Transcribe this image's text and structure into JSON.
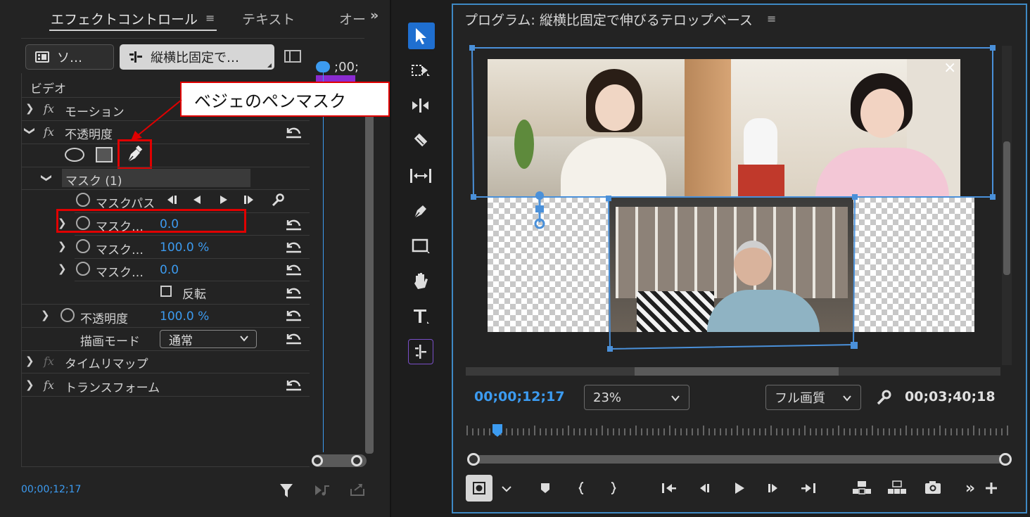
{
  "effect_controls": {
    "tabs": {
      "effect_controls": "エフェクトコントロール",
      "menu": "≡",
      "text": "テキスト",
      "audio": "オー",
      "overflow": "»"
    },
    "source_label": "ソ…",
    "sequence_label": "縦横比固定で…",
    "timecode_mini": ";00;",
    "section_video": "ビデオ",
    "rows": {
      "motion": "モーション",
      "opacity": "不透明度",
      "mask": "マスク (1)",
      "mask_path": "マスクパス",
      "mask_feather_label": "マスク…",
      "mask_feather_value": "0.0",
      "mask_opacity_label": "マスク…",
      "mask_opacity_value": "100.0 %",
      "mask_expansion_label": "マスク…",
      "mask_expansion_value": "0.0",
      "inverted": "反転",
      "opacity_param": "不透明度",
      "opacity_value": "100.0 %",
      "blend_mode": "描画モード",
      "blend_value": "通常",
      "time_remap": "タイムリマップ",
      "transform": "トランスフォーム"
    },
    "footer_timecode": "00;00;12;17"
  },
  "callout": {
    "text": "ベジェのペンマスク",
    "color": "#e00000"
  },
  "tools": [
    "selection-icon",
    "track-select-icon",
    "ripple-edit-icon",
    "razor-icon",
    "slip-icon",
    "pen-icon",
    "rectangle-icon",
    "hand-icon",
    "type-icon",
    "auto-reframe-icon"
  ],
  "program": {
    "title": "プログラム: 縦横比固定で伸びるテロップベース",
    "menu": "≡",
    "close": "×",
    "current_timecode": "00;00;12;17",
    "zoom": "23%",
    "quality": "フル画質",
    "duration": "00;03;40;18",
    "accent_color": "#3c9bf0"
  }
}
